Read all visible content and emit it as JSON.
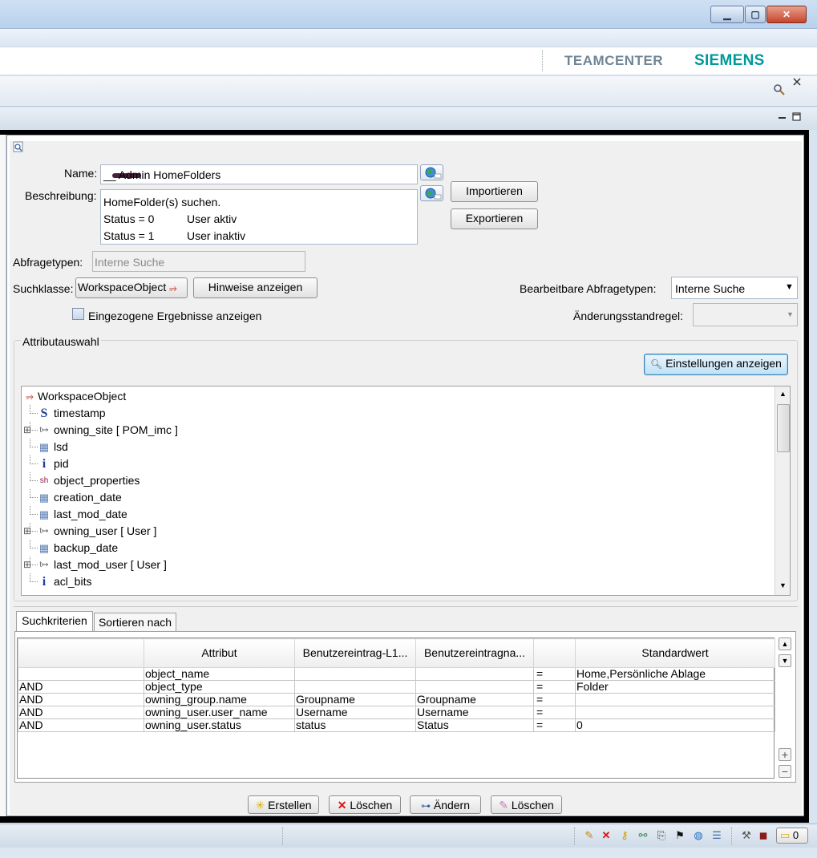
{
  "window": {
    "minimize_glyph": "▁",
    "maximize_glyph": "▢",
    "close_glyph": "✕"
  },
  "brand": {
    "product": "TEAMCENTER",
    "company": "SIEMENS"
  },
  "query": {
    "name_label": "Name:",
    "name_value": "__ Admin HomeFolders",
    "description_label": "Beschreibung:",
    "description_lines": [
      {
        "left": "HomeFolder(s) suchen.",
        "right": ""
      },
      {
        "left": "Status = 0",
        "right": "User aktiv"
      },
      {
        "left": "Status = 1",
        "right": "User inaktiv"
      }
    ],
    "import_button": "Importieren",
    "export_button": "Exportieren",
    "query_types_label": "Abfragetypen:",
    "query_types_value": "Interne Suche",
    "search_class_label": "Suchklasse:",
    "search_class_value": "WorkspaceObject",
    "hints_button": "Hinweise anzeigen",
    "editable_types_label": "Bearbeitbare Abfragetypen:",
    "editable_types_value": "Interne Suche",
    "show_retracted_label": "Eingezogene Ergebnisse anzeigen",
    "show_retracted_checked": false,
    "revision_rule_label": "Änderungsstandregel:",
    "revision_rule_value": ""
  },
  "attributes": {
    "group_title": "Attributauswahl",
    "settings_button": "Einstellungen anzeigen",
    "tree": [
      {
        "label": "WorkspaceObject",
        "icon": "class-icon",
        "glyph": "⭌",
        "expander": false,
        "level": 0
      },
      {
        "label": "timestamp",
        "icon": "string-icon",
        "glyph": "S",
        "expander": false,
        "level": 1
      },
      {
        "label": "owning_site [ POM_imc ]",
        "icon": "reference-icon",
        "glyph": "t↦",
        "expander": true,
        "level": 1
      },
      {
        "label": "lsd",
        "icon": "date-icon",
        "glyph": "▦",
        "expander": false,
        "level": 1
      },
      {
        "label": "pid",
        "icon": "integer-icon",
        "glyph": "i",
        "expander": false,
        "level": 1
      },
      {
        "label": "object_properties",
        "icon": "short-icon",
        "glyph": "sh",
        "expander": false,
        "level": 1
      },
      {
        "label": "creation_date",
        "icon": "date-icon",
        "glyph": "▦",
        "expander": false,
        "level": 1
      },
      {
        "label": "last_mod_date",
        "icon": "date-icon",
        "glyph": "▦",
        "expander": false,
        "level": 1
      },
      {
        "label": "owning_user [ User ]",
        "icon": "reference-icon",
        "glyph": "t↦",
        "expander": true,
        "level": 1
      },
      {
        "label": "backup_date",
        "icon": "date-icon",
        "glyph": "▦",
        "expander": false,
        "level": 1
      },
      {
        "label": "last_mod_user [ User ]",
        "icon": "reference-icon",
        "glyph": "t↦",
        "expander": true,
        "level": 1
      },
      {
        "label": "acl_bits",
        "icon": "integer-icon",
        "glyph": "i",
        "expander": false,
        "level": 1
      }
    ]
  },
  "criteria": {
    "tabs": [
      "Suchkriterien",
      "Sortieren nach"
    ],
    "active_tab": 0,
    "columns": [
      "",
      "Attribut",
      "Benutzereintrag-L1...",
      "Benutzereintragna...",
      "",
      "Standardwert"
    ],
    "rows": [
      [
        "",
        "object_name",
        "",
        "",
        "=",
        "Home,Persönliche Ablage"
      ],
      [
        "AND",
        "object_type",
        "",
        "",
        "=",
        "Folder"
      ],
      [
        "AND",
        "owning_group.name",
        "Groupname",
        "Groupname",
        "=",
        ""
      ],
      [
        "AND",
        "owning_user.user_name",
        "Username",
        "Username",
        "=",
        ""
      ],
      [
        "AND",
        "owning_user.status",
        "status",
        "Status",
        "=",
        "0"
      ]
    ]
  },
  "actions": {
    "create": "Erstellen",
    "delete": "Löschen",
    "modify": "Ändern",
    "clear": "Löschen"
  },
  "statusbar": {
    "counter": "0"
  }
}
